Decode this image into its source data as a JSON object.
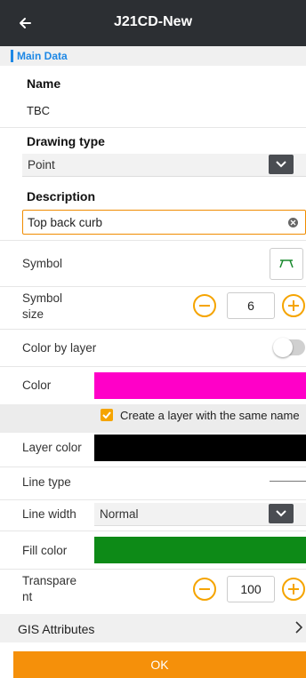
{
  "app_bar": {
    "title": "J21CD-New",
    "back_icon": "arrow-left-icon"
  },
  "section": {
    "title": "Main Data",
    "accent_color": "#1e88e5"
  },
  "name": {
    "label": "Name",
    "value": "TBC"
  },
  "drawing_type": {
    "label": "Drawing type",
    "value": "Point"
  },
  "description": {
    "label": "Description",
    "value": "Top back curb"
  },
  "symbol": {
    "label": "Symbol",
    "icon": "curb-symbol-icon"
  },
  "symbol_size": {
    "label_line1": "Symbol",
    "label_line2": "size",
    "value": "6"
  },
  "color_by_layer": {
    "label": "Color by layer",
    "enabled": false
  },
  "color": {
    "label": "Color",
    "value": "#ff00c8"
  },
  "create_layer": {
    "label": "Create a layer with the same name",
    "checked": true
  },
  "layer_color": {
    "label": "Layer color",
    "value": "#000000"
  },
  "line_type": {
    "label": "Line type"
  },
  "line_width": {
    "label": "Line width",
    "value": "Normal"
  },
  "fill_color": {
    "label": "Fill color",
    "value": "#0d8a17"
  },
  "transparency": {
    "label_line1": "Transpare",
    "label_line2": "nt",
    "value": "100"
  },
  "gis": {
    "label": "GIS Attributes"
  },
  "ok": {
    "label": "OK",
    "color": "#f5900a"
  }
}
